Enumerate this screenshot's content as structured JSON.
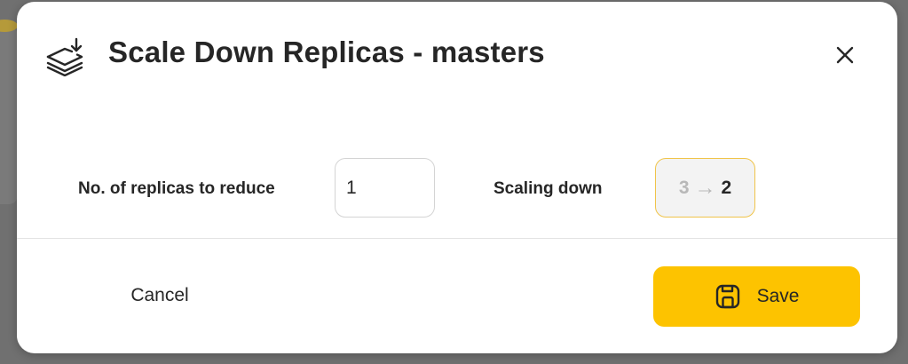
{
  "dialog": {
    "title": "Scale Down Replicas - masters",
    "header_icon": "layers-download-icon",
    "close_icon": "close-icon"
  },
  "form": {
    "replicas_label": "No. of replicas to reduce",
    "replicas_value": "1",
    "scaling_label": "Scaling down",
    "scaling_from": "3",
    "scaling_arrow": "→",
    "scaling_to": "2"
  },
  "footer": {
    "cancel_label": "Cancel",
    "save_label": "Save",
    "save_icon": "save-icon"
  },
  "colors": {
    "accent": "#fdc300",
    "scaling_border": "#f0c44a",
    "text": "#262626",
    "muted": "#b8b8b8"
  }
}
